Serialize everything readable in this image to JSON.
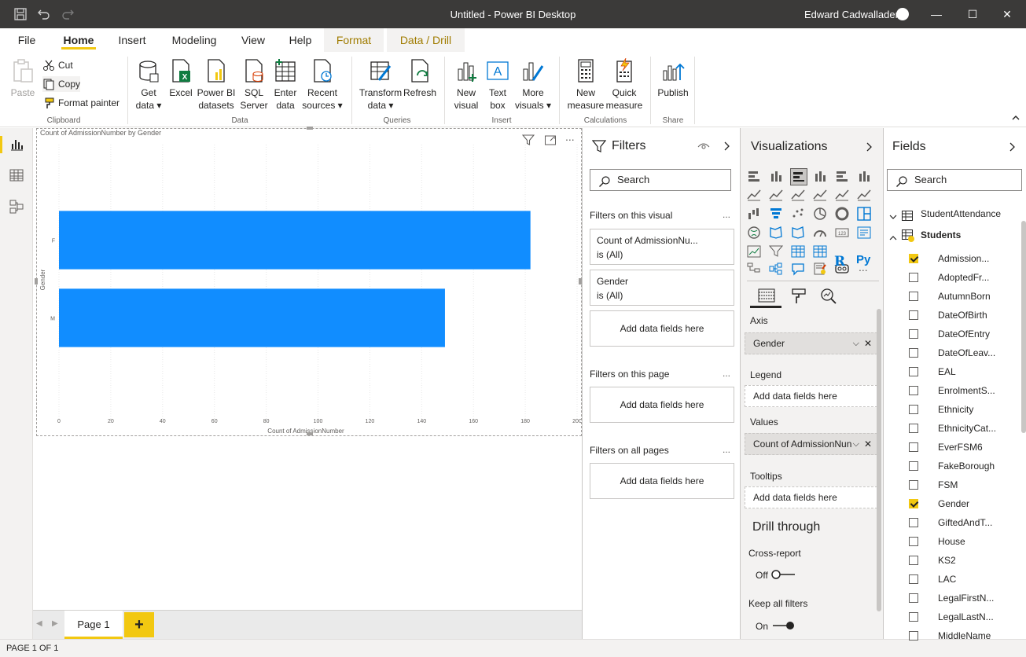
{
  "window": {
    "title": "Untitled - Power BI Desktop",
    "user": "Edward Cadwallader",
    "minimize": "—",
    "maximize": "☐",
    "close": "✕"
  },
  "tabs": {
    "file": "File",
    "home": "Home",
    "insert": "Insert",
    "modeling": "Modeling",
    "view": "View",
    "help": "Help",
    "format": "Format",
    "data_drill": "Data / Drill"
  },
  "ribbon": {
    "clipboard": {
      "paste": "Paste",
      "cut": "Cut",
      "copy": "Copy",
      "format_painter": "Format painter",
      "group": "Clipboard"
    },
    "data": {
      "get_data_1": "Get",
      "get_data_2": "data",
      "excel": "Excel",
      "pbi_1": "Power BI",
      "pbi_2": "datasets",
      "sql_1": "SQL",
      "sql_2": "Server",
      "enter_1": "Enter",
      "enter_2": "data",
      "recent_1": "Recent",
      "recent_2": "sources",
      "group": "Data"
    },
    "queries": {
      "transform_1": "Transform",
      "transform_2": "data",
      "refresh": "Refresh",
      "group": "Queries"
    },
    "insert": {
      "new_visual_1": "New",
      "new_visual_2": "visual",
      "text_box_1": "Text",
      "text_box_2": "box",
      "more_visuals_1": "More",
      "more_visuals_2": "visuals",
      "group": "Insert"
    },
    "calculations": {
      "new_measure_1": "New",
      "new_measure_2": "measure",
      "quick_measure_1": "Quick",
      "quick_measure_2": "measure",
      "group": "Calculations"
    },
    "share": {
      "publish": "Publish",
      "group": "Share"
    }
  },
  "chart_data": {
    "type": "bar",
    "orientation": "horizontal",
    "title": "Count of AdmissionNumber by Gender",
    "categories": [
      "F",
      "M"
    ],
    "values": [
      182,
      149
    ],
    "xlabel": "Count of AdmissionNumber",
    "ylabel": "Gender",
    "xlim": [
      0,
      200
    ],
    "xticks": [
      0,
      20,
      40,
      60,
      80,
      100,
      120,
      140,
      160,
      180,
      200
    ],
    "bar_color": "#118dff",
    "grid": true
  },
  "pages": {
    "page1": "Page 1",
    "add": "+"
  },
  "status": "PAGE 1 OF 1",
  "filters": {
    "title": "Filters",
    "search": "Search",
    "on_visual": "Filters on this visual",
    "card1_name": "Count of AdmissionNu...",
    "card1_state": "is (All)",
    "card2_name": "Gender",
    "card2_state": "is (All)",
    "add_fields": "Add data fields here",
    "on_page": "Filters on this page",
    "on_all": "Filters on all pages",
    "more": "..."
  },
  "visualizations": {
    "title": "Visualizations",
    "axis": "Axis",
    "axis_value": "Gender",
    "legend": "Legend",
    "legend_value": "Add data fields here",
    "values": "Values",
    "values_value": "Count of AdmissionNun",
    "tooltips": "Tooltips",
    "tooltips_value": "Add data fields here",
    "drill_through": "Drill through",
    "cross_report": "Cross-report",
    "cross_state": "Off",
    "keep_filters": "Keep all filters",
    "keep_state": "On",
    "r_icon": "R",
    "py_icon": "Py",
    "more": "..."
  },
  "fields": {
    "title": "Fields",
    "search": "Search",
    "tables": [
      "StudentAttendance",
      "Students"
    ],
    "items": [
      {
        "name": "Admission...",
        "checked": true
      },
      {
        "name": "AdoptedFr...",
        "checked": false
      },
      {
        "name": "AutumnBorn",
        "checked": false
      },
      {
        "name": "DateOfBirth",
        "checked": false
      },
      {
        "name": "DateOfEntry",
        "checked": false
      },
      {
        "name": "DateOfLeav...",
        "checked": false
      },
      {
        "name": "EAL",
        "checked": false
      },
      {
        "name": "EnrolmentS...",
        "checked": false
      },
      {
        "name": "Ethnicity",
        "checked": false
      },
      {
        "name": "EthnicityCat...",
        "checked": false
      },
      {
        "name": "EverFSM6",
        "checked": false
      },
      {
        "name": "FakeBorough",
        "checked": false
      },
      {
        "name": "FSM",
        "checked": false
      },
      {
        "name": "Gender",
        "checked": true
      },
      {
        "name": "GiftedAndT...",
        "checked": false
      },
      {
        "name": "House",
        "checked": false
      },
      {
        "name": "KS2",
        "checked": false
      },
      {
        "name": "LAC",
        "checked": false
      },
      {
        "name": "LegalFirstN...",
        "checked": false
      },
      {
        "name": "LegalLastN...",
        "checked": false
      },
      {
        "name": "MiddleName",
        "checked": false
      }
    ]
  }
}
